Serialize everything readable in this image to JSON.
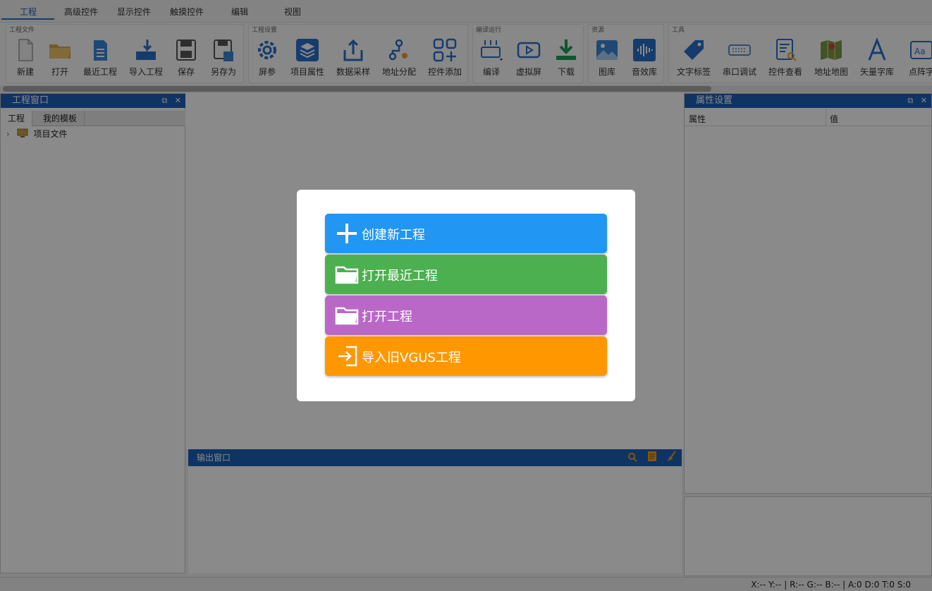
{
  "menu": {
    "tabs": [
      "工程",
      "高级控件",
      "显示控件",
      "触摸控件",
      "编辑",
      "视图"
    ],
    "active": "工程"
  },
  "ribbon": {
    "groups": [
      {
        "label": "工程文件",
        "tools": [
          {
            "label": "新建",
            "icon": "new-file-icon"
          },
          {
            "label": "打开",
            "icon": "open-folder-icon"
          },
          {
            "label": "最近工程",
            "icon": "recent-document-icon"
          },
          {
            "label": "导入工程",
            "icon": "import-icon"
          },
          {
            "label": "保存",
            "icon": "save-icon"
          },
          {
            "label": "另存为",
            "icon": "save-as-icon"
          }
        ]
      },
      {
        "label": "工程设置",
        "tools": [
          {
            "label": "屏参",
            "icon": "gear-icon"
          },
          {
            "label": "项目属性",
            "icon": "layers-icon"
          },
          {
            "label": "数据采样",
            "icon": "upload-tray-icon"
          },
          {
            "label": "地址分配",
            "icon": "address-network-icon"
          },
          {
            "label": "控件添加",
            "icon": "grid-add-icon"
          }
        ]
      },
      {
        "label": "编译运行",
        "tools": [
          {
            "label": "编译",
            "icon": "compile-icon"
          },
          {
            "label": "虚拟屏",
            "icon": "play-screen-icon"
          },
          {
            "label": "下载",
            "icon": "download-icon"
          }
        ]
      },
      {
        "label": "资源",
        "tools": [
          {
            "label": "图库",
            "icon": "image-library-icon"
          },
          {
            "label": "音效库",
            "icon": "audio-library-icon"
          }
        ]
      },
      {
        "label": "工具",
        "tools": [
          {
            "label": "文字标签",
            "icon": "tag-icon"
          },
          {
            "label": "串口调试",
            "icon": "serial-port-icon"
          },
          {
            "label": "控件查看",
            "icon": "inspect-document-icon"
          },
          {
            "label": "地址地图",
            "icon": "map-icon"
          },
          {
            "label": "矢量字库",
            "icon": "vector-font-icon"
          },
          {
            "label": "点阵字",
            "icon": "bitmap-font-icon"
          }
        ]
      }
    ]
  },
  "left_panel": {
    "title": "工程窗口",
    "tabs": [
      "工程",
      "我的模板"
    ],
    "tree_item": "项目文件"
  },
  "right_panel": {
    "title": "属性设置",
    "col_property": "属性",
    "col_value": "值"
  },
  "output_panel": {
    "title": "输出窗口"
  },
  "status": {
    "text": "X:--  Y:--  |  R:-- G:-- B:--  |  A:0  D:0  T:0  S:0"
  },
  "dialog": {
    "buttons": [
      {
        "label": "创建新工程",
        "color": "#2196f3",
        "icon": "plus-icon"
      },
      {
        "label": "打开最近工程",
        "color": "#4caf50",
        "icon": "folder-icon"
      },
      {
        "label": "打开工程",
        "color": "#ba68c8",
        "icon": "folder-icon"
      },
      {
        "label": "导入旧VGUS工程",
        "color": "#ff9800",
        "icon": "import-arrow-icon"
      }
    ]
  },
  "colors": {
    "panel_header": "#1c5eb8",
    "accent": "#2b6fc4"
  }
}
